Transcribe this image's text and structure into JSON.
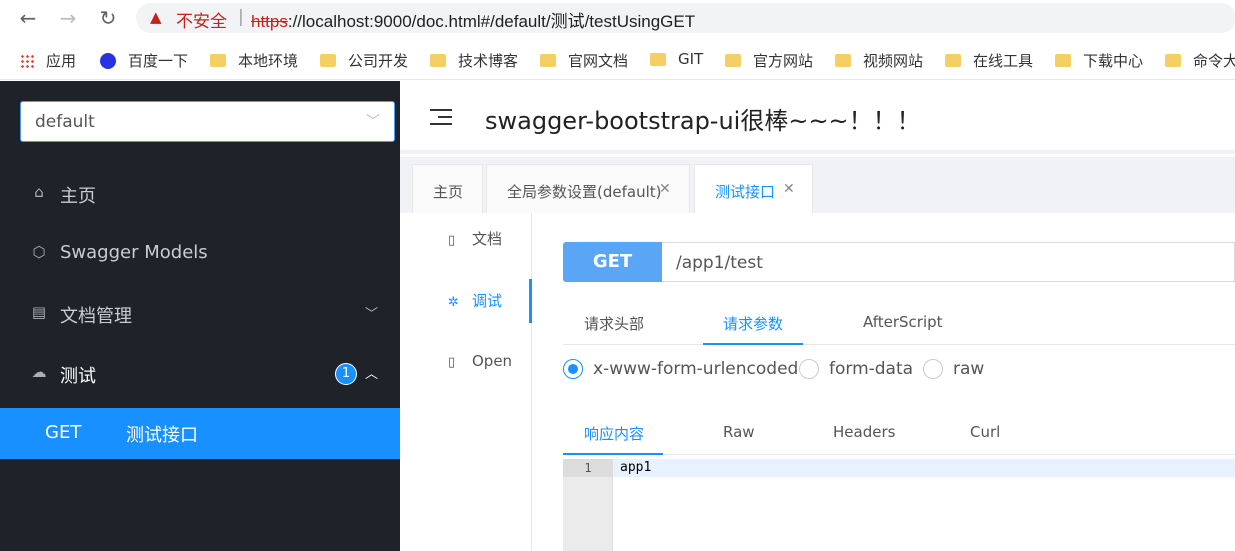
{
  "browser": {
    "warning_text": "不安全",
    "url_scheme": "https",
    "url_rest": "://localhost:9000/doc.html#/default/测试/testUsingGET"
  },
  "bookmarks": [
    "应用",
    "百度一下",
    "本地环境",
    "公司开发",
    "技术博客",
    "官网文档",
    "GIT",
    "官方网站",
    "视频网站",
    "在线工具",
    "下载中心",
    "命令大"
  ],
  "sidebar": {
    "group_select": "default",
    "items": [
      {
        "icon": "home-icon",
        "label": "主页"
      },
      {
        "icon": "cube-icon",
        "label": "Swagger Models"
      },
      {
        "icon": "document-manage-icon",
        "label": "文档管理"
      },
      {
        "icon": "cloud-icon",
        "label": "测试",
        "badge": "1"
      }
    ],
    "active_sub": {
      "method": "GET",
      "label": "测试接口"
    }
  },
  "header": {
    "title": "swagger-bootstrap-ui很棒~~~！！！"
  },
  "tabs": [
    "主页",
    "全局参数设置(default)",
    "测试接口"
  ],
  "content": {
    "side_menu": [
      "文档",
      "调试",
      "Open"
    ],
    "method": "GET",
    "path": "/app1/test",
    "request_tabs": [
      "请求头部",
      "请求参数",
      "AfterScript"
    ],
    "encodings": [
      "x-www-form-urlencoded",
      "form-data",
      "raw"
    ],
    "response_tabs": [
      "响应内容",
      "Raw",
      "Headers",
      "Curl"
    ],
    "editor": {
      "line_number": "1",
      "code": "app1"
    }
  },
  "colors": {
    "accent": "#1890ff",
    "sidebar_bg": "#1f2329",
    "method_bg": "#5aa6f5"
  }
}
